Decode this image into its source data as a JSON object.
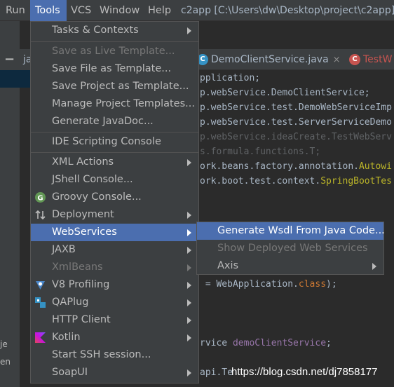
{
  "menubar": {
    "items": [
      {
        "label": "Run"
      },
      {
        "label": "Tools"
      },
      {
        "label": "VCS"
      },
      {
        "label": "Window"
      },
      {
        "label": "Help"
      }
    ],
    "window_title": "c2app [C:\\Users\\dw\\Desktop\\project\\c2app] -"
  },
  "project_panel": {
    "tab_fragment": "ja",
    "tree_fragments": [
      "je",
      "en"
    ]
  },
  "editor_tabs": [
    {
      "icon": "C",
      "label": "DemoClientService.java",
      "close": "×"
    },
    {
      "icon": "C",
      "label": "TestW"
    }
  ],
  "code_lines": [
    "pplication;",
    "p.webService.DemoClientService;",
    "p.webService.test.DemoWebServiceImp",
    "p.webService.test.ServerServiceDemo",
    "p.webService.ideaCreate.TestWebServ",
    "s.formula.functions.T;",
    "ork.beans.factory.annotation.",
    "Autowi",
    "ork.boot.test.context.",
    "SpringBootTes",
    " = WebApplication.",
    "class",
    ");",
    "rvice ",
    "demoClientService",
    ";",
    "api.Te"
  ],
  "tools_menu": {
    "items": [
      {
        "label": "Tasks & Contexts",
        "submenu": true,
        "enabled": true
      },
      {
        "label": "Save as Live Template...",
        "submenu": false,
        "enabled": false
      },
      {
        "label": "Save File as Template...",
        "submenu": false,
        "enabled": true
      },
      {
        "label": "Save Project as Template...",
        "submenu": false,
        "enabled": true
      },
      {
        "label": "Manage Project Templates...",
        "submenu": false,
        "enabled": true
      },
      {
        "label": "Generate JavaDoc...",
        "submenu": false,
        "enabled": true
      },
      {
        "label": "IDE Scripting Console",
        "submenu": false,
        "enabled": true
      },
      {
        "label": "XML Actions",
        "submenu": true,
        "enabled": true
      },
      {
        "label": "JShell Console...",
        "submenu": false,
        "enabled": true
      },
      {
        "label": "Groovy Console...",
        "submenu": false,
        "enabled": true,
        "icon": "groovy-icon"
      },
      {
        "label": "Deployment",
        "submenu": true,
        "enabled": true,
        "icon": "deployment-icon"
      },
      {
        "label": "WebServices",
        "submenu": true,
        "enabled": true,
        "selected": true
      },
      {
        "label": "JAXB",
        "submenu": true,
        "enabled": true
      },
      {
        "label": "XmlBeans",
        "submenu": true,
        "enabled": false
      },
      {
        "label": "V8 Profiling",
        "submenu": true,
        "enabled": true,
        "icon": "v8-icon"
      },
      {
        "label": "QAPlug",
        "submenu": true,
        "enabled": true,
        "icon": "qaplug-icon"
      },
      {
        "label": "HTTP Client",
        "submenu": true,
        "enabled": true
      },
      {
        "label": "Kotlin",
        "submenu": true,
        "enabled": true,
        "icon": "kotlin-icon"
      },
      {
        "label": "Start SSH session...",
        "submenu": false,
        "enabled": true
      },
      {
        "label": "SoapUI",
        "submenu": true,
        "enabled": true
      }
    ]
  },
  "webservices_submenu": {
    "items": [
      {
        "label": "Generate Wsdl From Java Code...",
        "enabled": true,
        "selected": true
      },
      {
        "label": "Show Deployed Web Services",
        "enabled": false
      },
      {
        "label": "Axis",
        "enabled": true,
        "submenu": true
      }
    ]
  },
  "watermark": "https://blog.csdn.net/dj7858177",
  "colors": {
    "menu_bg": "#3c3f41",
    "selection": "#4b6eaf",
    "editor_bg": "#2b2b2b"
  }
}
